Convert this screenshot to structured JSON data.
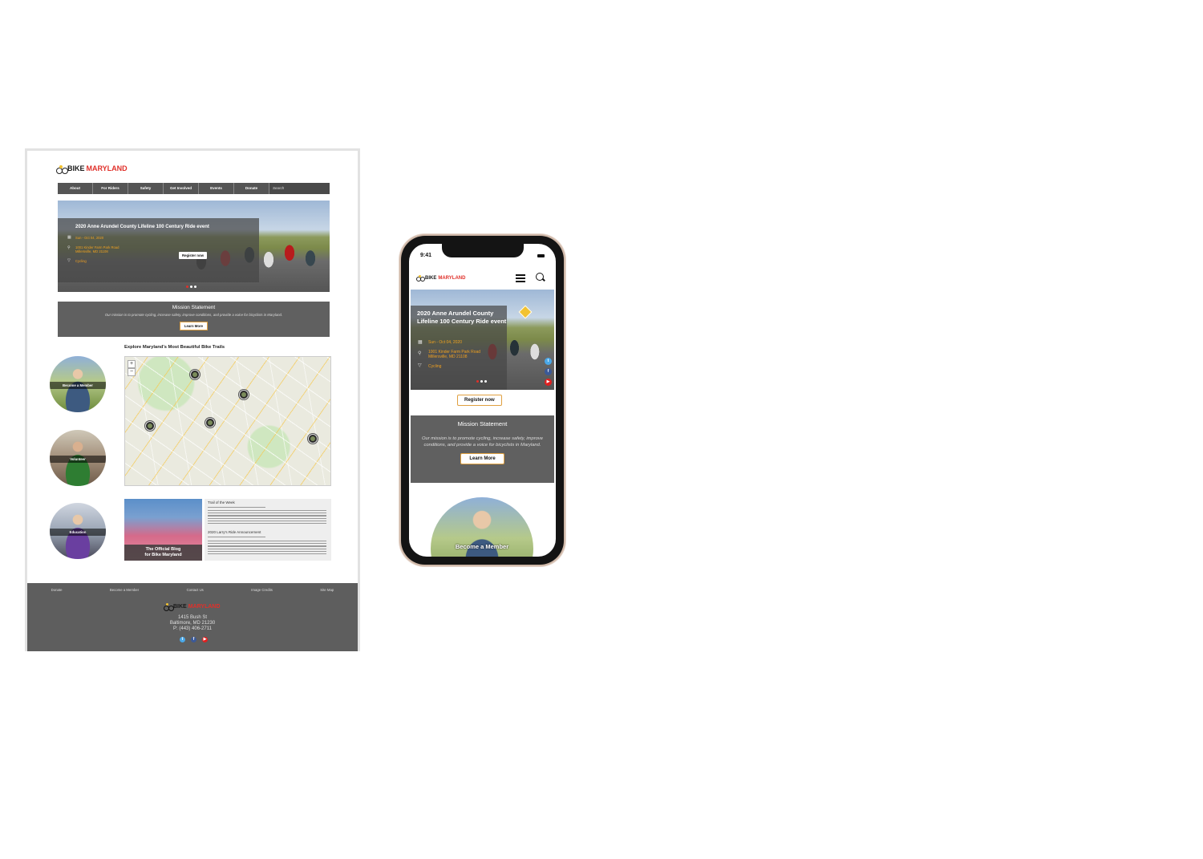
{
  "brand": {
    "bike": "BIKE",
    "maryland": "MARYLAND",
    "red": "#e0302a"
  },
  "desktop": {
    "nav": [
      "About",
      "For Riders",
      "Safety",
      "Get Involved",
      "Events",
      "Donate"
    ],
    "search_placeholder": "Search",
    "hero": {
      "title": "2020 Anne Arundel County Lifeline 100 Century Ride event",
      "date": "Sun - Oct 04, 2020",
      "address_line1": "1001 Kinder Farm Park Road",
      "address_line2": "Millersville, MD 21108",
      "category": "Cycling",
      "register": "Register now"
    },
    "mission": {
      "heading": "Mission Statement",
      "text": "Our mission is to promote cycling, increase safety, improve conditions, and provide a voice for bicyclists in Maryland.",
      "button": "Learn More"
    },
    "trails_heading": "Explore Maryland's Most Beautiful Bike Trails",
    "circles": [
      "Become a Member",
      "Volunteer",
      "Education"
    ],
    "blog": {
      "caption_line1": "The Official Blog",
      "caption_line2": "for Bike Maryland",
      "heading1": "Trail of the Week",
      "heading2": "2020 Larry's Ride Announcement"
    },
    "footer": {
      "links": [
        "Donate",
        "Become a Member",
        "Contact Us",
        "Image Credits",
        "Site Map"
      ],
      "street": "1415 Bush St",
      "city": "Baltimore, MD 21230",
      "phone": "P: (443) 406-2711"
    }
  },
  "phone": {
    "time": "9:41",
    "hero": {
      "title": "2020 Anne Arundel County Lifeline 100 Century Ride event",
      "date": "Sun - Oct 04, 2020",
      "address_line1": "1001 Kinder Farm Park Road",
      "address_line2": "Millersville, MD 21108",
      "category": "Cycling"
    },
    "register": "Register now",
    "mission": {
      "heading": "Mission Statement",
      "text": "Our mission is to promote cycling, increase safety, improve conditions, and provide a voice for bicyclists in Maryland.",
      "button": "Learn More"
    },
    "member_label": "Become a Member"
  },
  "icons": {
    "calendar": "calendar-icon",
    "location": "location-pin-icon",
    "category": "filter-icon",
    "menu": "hamburger-menu-icon",
    "search": "search-icon",
    "twitter": "twitter-icon",
    "facebook": "facebook-icon",
    "youtube": "youtube-icon"
  }
}
